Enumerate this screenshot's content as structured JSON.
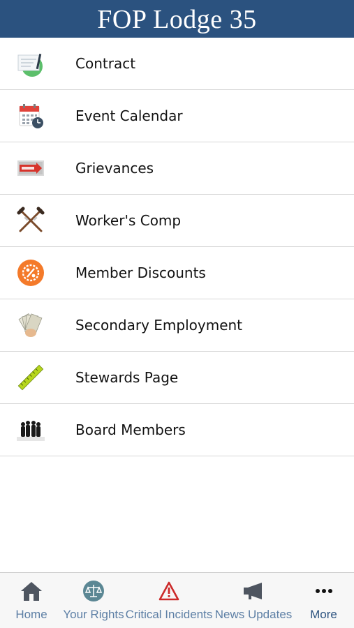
{
  "header": {
    "title": "FOP Lodge 35"
  },
  "menu": {
    "items": [
      {
        "label": "Contract",
        "icon": "contract-icon"
      },
      {
        "label": "Event Calendar",
        "icon": "calendar-icon"
      },
      {
        "label": "Grievances",
        "icon": "grievances-sign-icon"
      },
      {
        "label": "Worker's Comp",
        "icon": "crutches-icon"
      },
      {
        "label": "Member Discounts",
        "icon": "discount-percent-icon"
      },
      {
        "label": "Secondary Employment",
        "icon": "money-icon"
      },
      {
        "label": "Stewards Page",
        "icon": "ruler-icon"
      },
      {
        "label": "Board Members",
        "icon": "group-silhouette-icon"
      }
    ]
  },
  "tabbar": {
    "tabs": [
      {
        "label": "Home",
        "icon": "home-icon"
      },
      {
        "label": "Your Rights",
        "icon": "scales-icon"
      },
      {
        "label": "Critical Incidents",
        "icon": "warning-icon"
      },
      {
        "label": "News Updates",
        "icon": "megaphone-icon"
      },
      {
        "label": "More",
        "icon": "more-dots-icon"
      }
    ]
  },
  "colors": {
    "header_bg": "#2b527f",
    "tab_label": "#5d7fa5",
    "tab_label_active": "#2b527f",
    "divider": "#d6d6d6"
  }
}
